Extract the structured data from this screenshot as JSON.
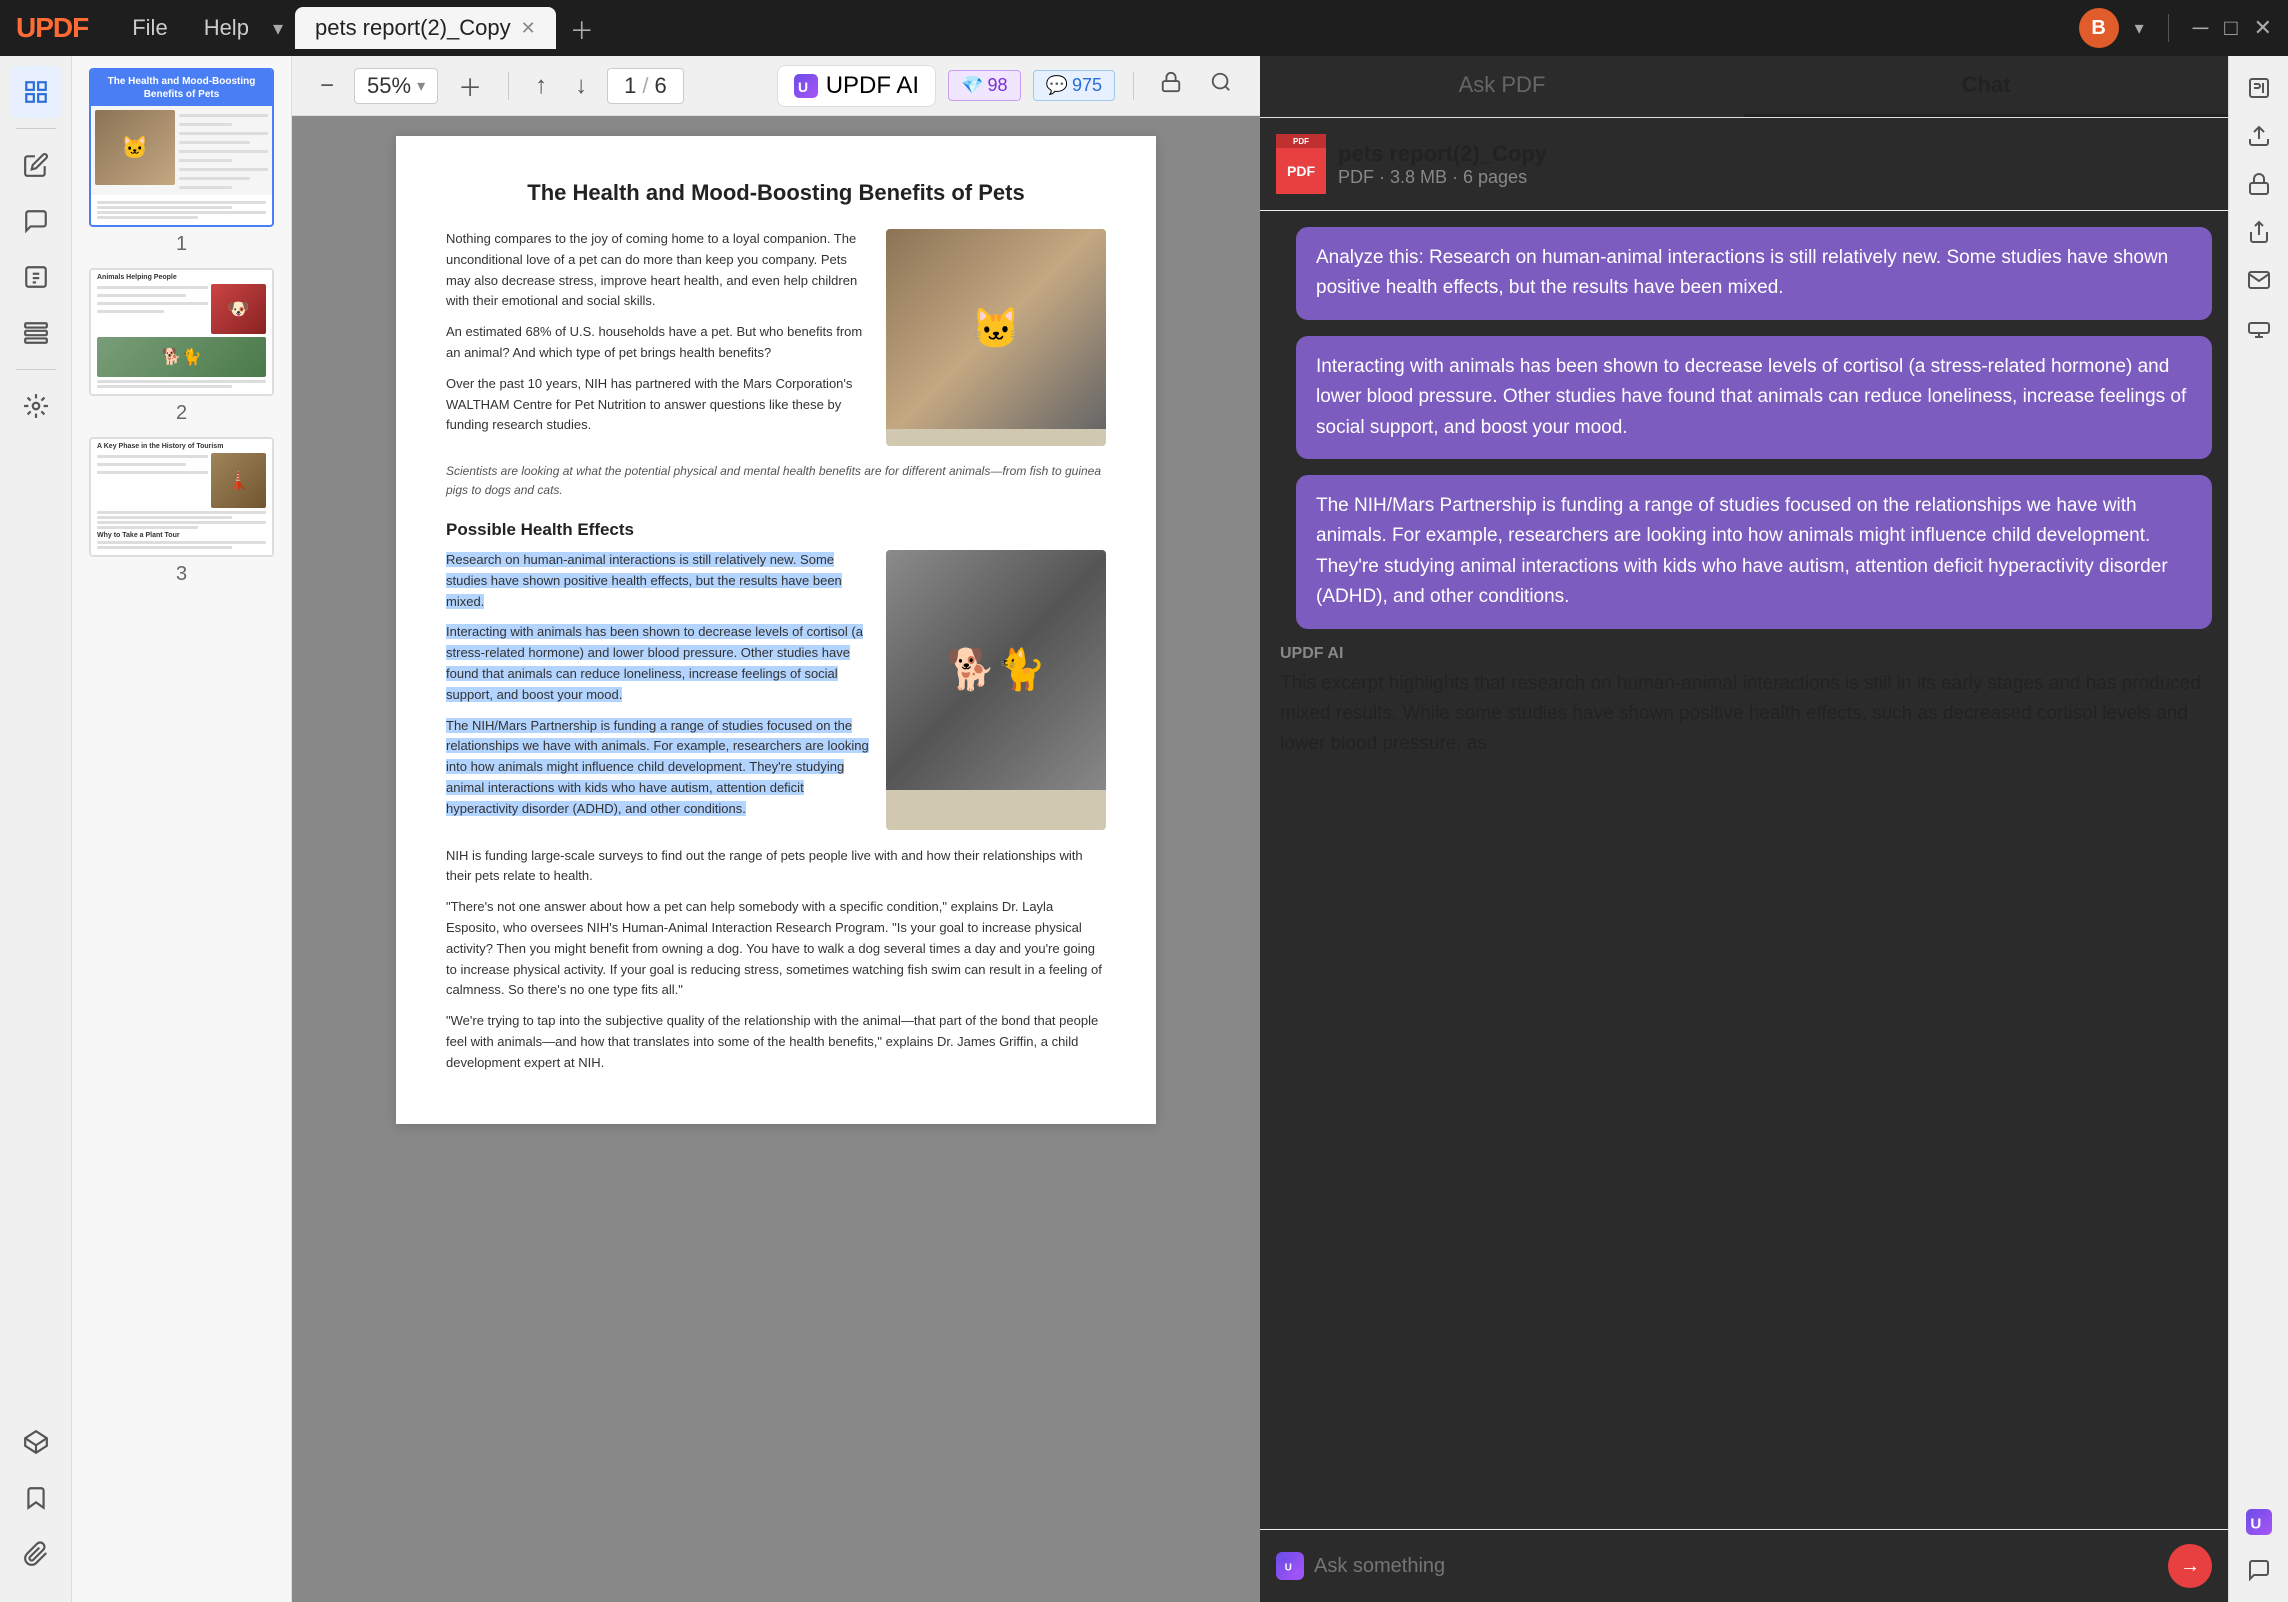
{
  "app": {
    "logo": "UPDF",
    "menus": [
      "File",
      "Help"
    ]
  },
  "tabs": [
    {
      "id": "tab1",
      "label": "pets report(2)_Copy",
      "active": true
    }
  ],
  "toolbar": {
    "zoom_level": "55%",
    "zoom_dropdown": "▾",
    "page_current": "1",
    "page_total": "6",
    "updf_ai_label": "UPDF AI",
    "credits_purple": "98",
    "credits_blue": "975"
  },
  "sidebar": {
    "icons": [
      {
        "name": "thumbnails-icon",
        "symbol": "⊞",
        "active": true
      },
      {
        "name": "bookmarks-icon",
        "symbol": "🔖",
        "active": false
      },
      {
        "name": "text-icon",
        "symbol": "T",
        "active": false
      },
      {
        "name": "comments-icon",
        "symbol": "💬",
        "active": false
      },
      {
        "name": "layers-icon",
        "symbol": "⊡",
        "active": false
      },
      {
        "name": "search-sidebar-icon",
        "symbol": "🔍",
        "active": false
      },
      {
        "name": "stack-icon",
        "symbol": "⧉",
        "active": false
      },
      {
        "name": "bookmark-icon",
        "symbol": "🏷",
        "active": false
      },
      {
        "name": "paperclip-icon",
        "symbol": "📎",
        "active": false
      }
    ]
  },
  "thumbnails": [
    {
      "num": "1",
      "active": true
    },
    {
      "num": "2",
      "active": false
    },
    {
      "num": "3",
      "active": false
    }
  ],
  "pdf": {
    "title": "The Health and Mood-Boosting Benefits of Pets",
    "intro_text": "Nothing compares to the joy of coming home to a loyal companion. The unconditional love of a pet can do more than keep you company. Pets may also decrease stress, improve heart health, and even help children with their emotional and social skills.",
    "intro_text2": "An estimated 68% of U.S. households have a pet. But who benefits from an animal? And which type of pet brings health benefits?",
    "intro_text3": "Over the past 10 years, NIH has partnered with the Mars Corporation's WALTHAM Centre for Pet Nutrition to answer questions like these by funding research studies.",
    "caption1": "Scientists are looking at what the potential physical and mental health benefits are for different animals—from fish to guinea pigs to dogs and cats.",
    "section1": "Possible Health Effects",
    "health_text1": "Research on human-animal interactions is still relatively new. Some studies have shown positive health effects, but the results have been mixed.",
    "health_text2": "Interacting with animals has been shown to decrease levels of cortisol (a stress-related hormone) and lower blood pressure. Other studies have found that animals can reduce loneliness, increase feelings of social support, and boost your mood.",
    "nih_text": "The NIH/Mars Partnership is funding a range of studies focused on the relationships we have with animals. For example, researchers are looking into how animals might influence child development. They're studying animal interactions with kids who have autism, attention deficit hyperactivity disorder (ADHD), and other conditions.",
    "survey_text": "NIH is funding large-scale surveys to find out the range of pets people live with and how their relationships with their pets relate to health.",
    "quote_text": "\"There's not one answer about how a pet can help somebody with a specific condition,\" explains Dr. Layla Esposito, who oversees NIH's Human-Animal Interaction Research Program. \"Is your goal to increase physical activity? Then you might benefit from owning a dog. You have to walk a dog several times a day and you're going to increase physical activity. If your goal is reducing stress, sometimes watching fish swim can result in a feeling of calmness. So there's no one type fits all.\"",
    "quote_text2": "\"We're trying to tap into the subjective quality of the relationship with the animal—that part of the bond that people feel with animals—and how that translates into some of the health benefits,\" explains Dr. James Griffin, a child development expert at NIH.",
    "section2_partial": "Animals Helping People"
  },
  "ai_panel": {
    "tab_ask": "Ask PDF",
    "tab_chat": "Chat",
    "active_tab": "chat",
    "file": {
      "name": "pets report(2)_Copy",
      "format": "PDF",
      "meta": "PDF · 3.8 MB · 6 pages"
    },
    "messages": [
      {
        "role": "user",
        "text": "Analyze this: Research on human-animal interactions is still relatively new. Some studies have shown positive health effects, but the results have been mixed."
      },
      {
        "role": "user",
        "text": "Interacting with animals has been shown to decrease levels of cortisol (a stress-related hormone) and lower blood pressure. Other studies have found that animals can reduce loneliness, increase feelings of social support, and boost your mood."
      },
      {
        "role": "user",
        "text": "The NIH/Mars Partnership is funding a range of studies focused on the relationships we have with animals. For example, researchers are looking into how animals might influence child development. They're studying animal interactions with kids who have autism, attention deficit hyperactivity disorder (ADHD), and other conditions."
      },
      {
        "role": "ai",
        "label": "UPDF AI",
        "text": "This excerpt highlights that research on human-animal interactions is still in its early stages and has produced mixed results. While some studies have shown positive health effects, such as decreased cortisol levels and lower blood pressure, as"
      }
    ],
    "input_placeholder": "Ask something",
    "send_label": "→"
  },
  "right_sidebar_icons": [
    {
      "name": "ocr-icon",
      "symbol": "OCR"
    },
    {
      "name": "export-icon",
      "symbol": "⬆"
    },
    {
      "name": "lock-icon",
      "symbol": "🔒"
    },
    {
      "name": "share-icon",
      "symbol": "↑"
    },
    {
      "name": "mail-icon",
      "symbol": "✉"
    },
    {
      "name": "stamp-icon",
      "symbol": "⊕"
    }
  ]
}
